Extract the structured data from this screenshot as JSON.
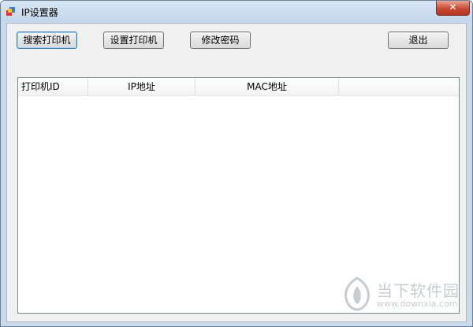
{
  "window": {
    "title": "IP设置器",
    "close_label": "✕"
  },
  "toolbar": {
    "search_label": "搜索打印机",
    "set_label": "设置打印机",
    "change_password_label": "修改密码",
    "exit_label": "退出"
  },
  "table": {
    "columns": [
      "打印机ID",
      "IP地址",
      "MAC地址"
    ],
    "rows": []
  },
  "watermark": {
    "brand": "当下软件园",
    "url": "www.downxia.com"
  }
}
